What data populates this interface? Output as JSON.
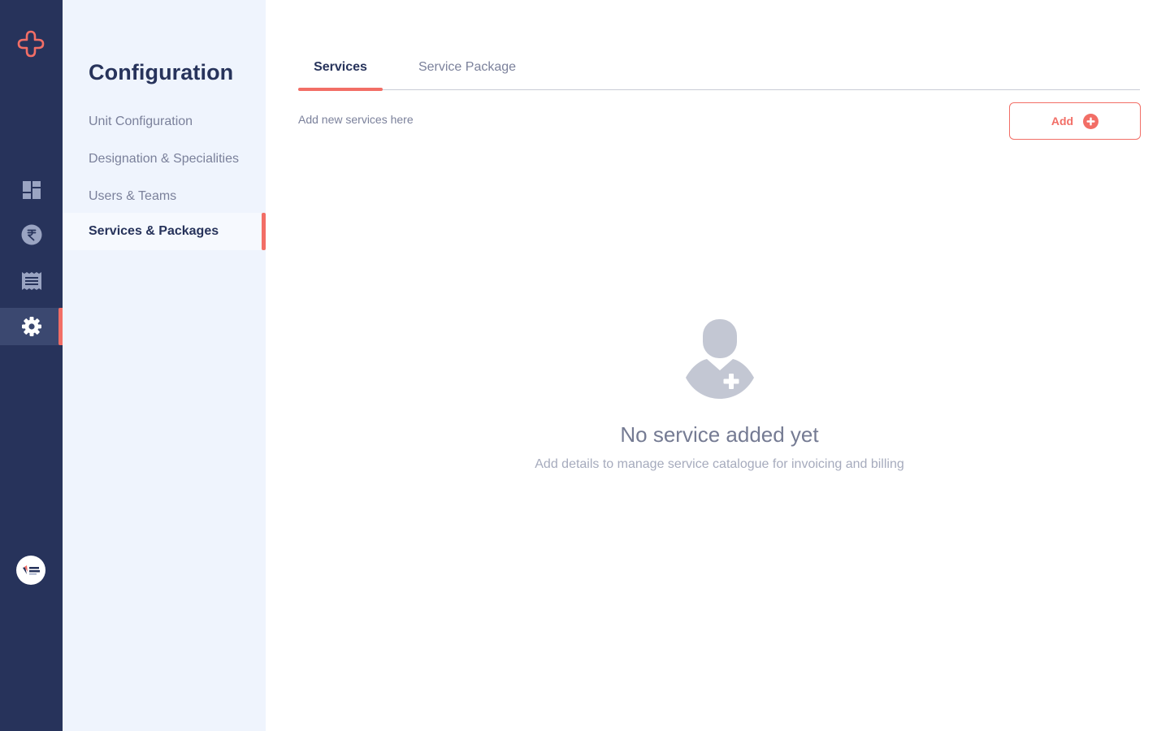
{
  "rail": {
    "icons": [
      "brand-plus-icon",
      "dashboard-icon",
      "rupee-icon",
      "receipt-icon",
      "settings-icon"
    ],
    "avatar_name": "hospital-logo-avatar"
  },
  "config": {
    "title": "Configuration",
    "items": [
      {
        "label": "Unit Configuration"
      },
      {
        "label": "Designation & Specialities"
      },
      {
        "label": "Users & Teams"
      },
      {
        "label": "Services & Packages"
      }
    ]
  },
  "main": {
    "tabs": [
      {
        "label": "Services"
      },
      {
        "label": "Service Package"
      }
    ],
    "subtitle": "Add new services here",
    "add_label": "Add",
    "empty": {
      "title": "No service added yet",
      "description": "Add details to manage service catalogue for invoicing and billing"
    }
  },
  "colors": {
    "rail": "#27335b",
    "sidebar": "#eff4fd",
    "accent": "#f26e66",
    "heading": "#27335b",
    "muted": "#7b819b"
  }
}
